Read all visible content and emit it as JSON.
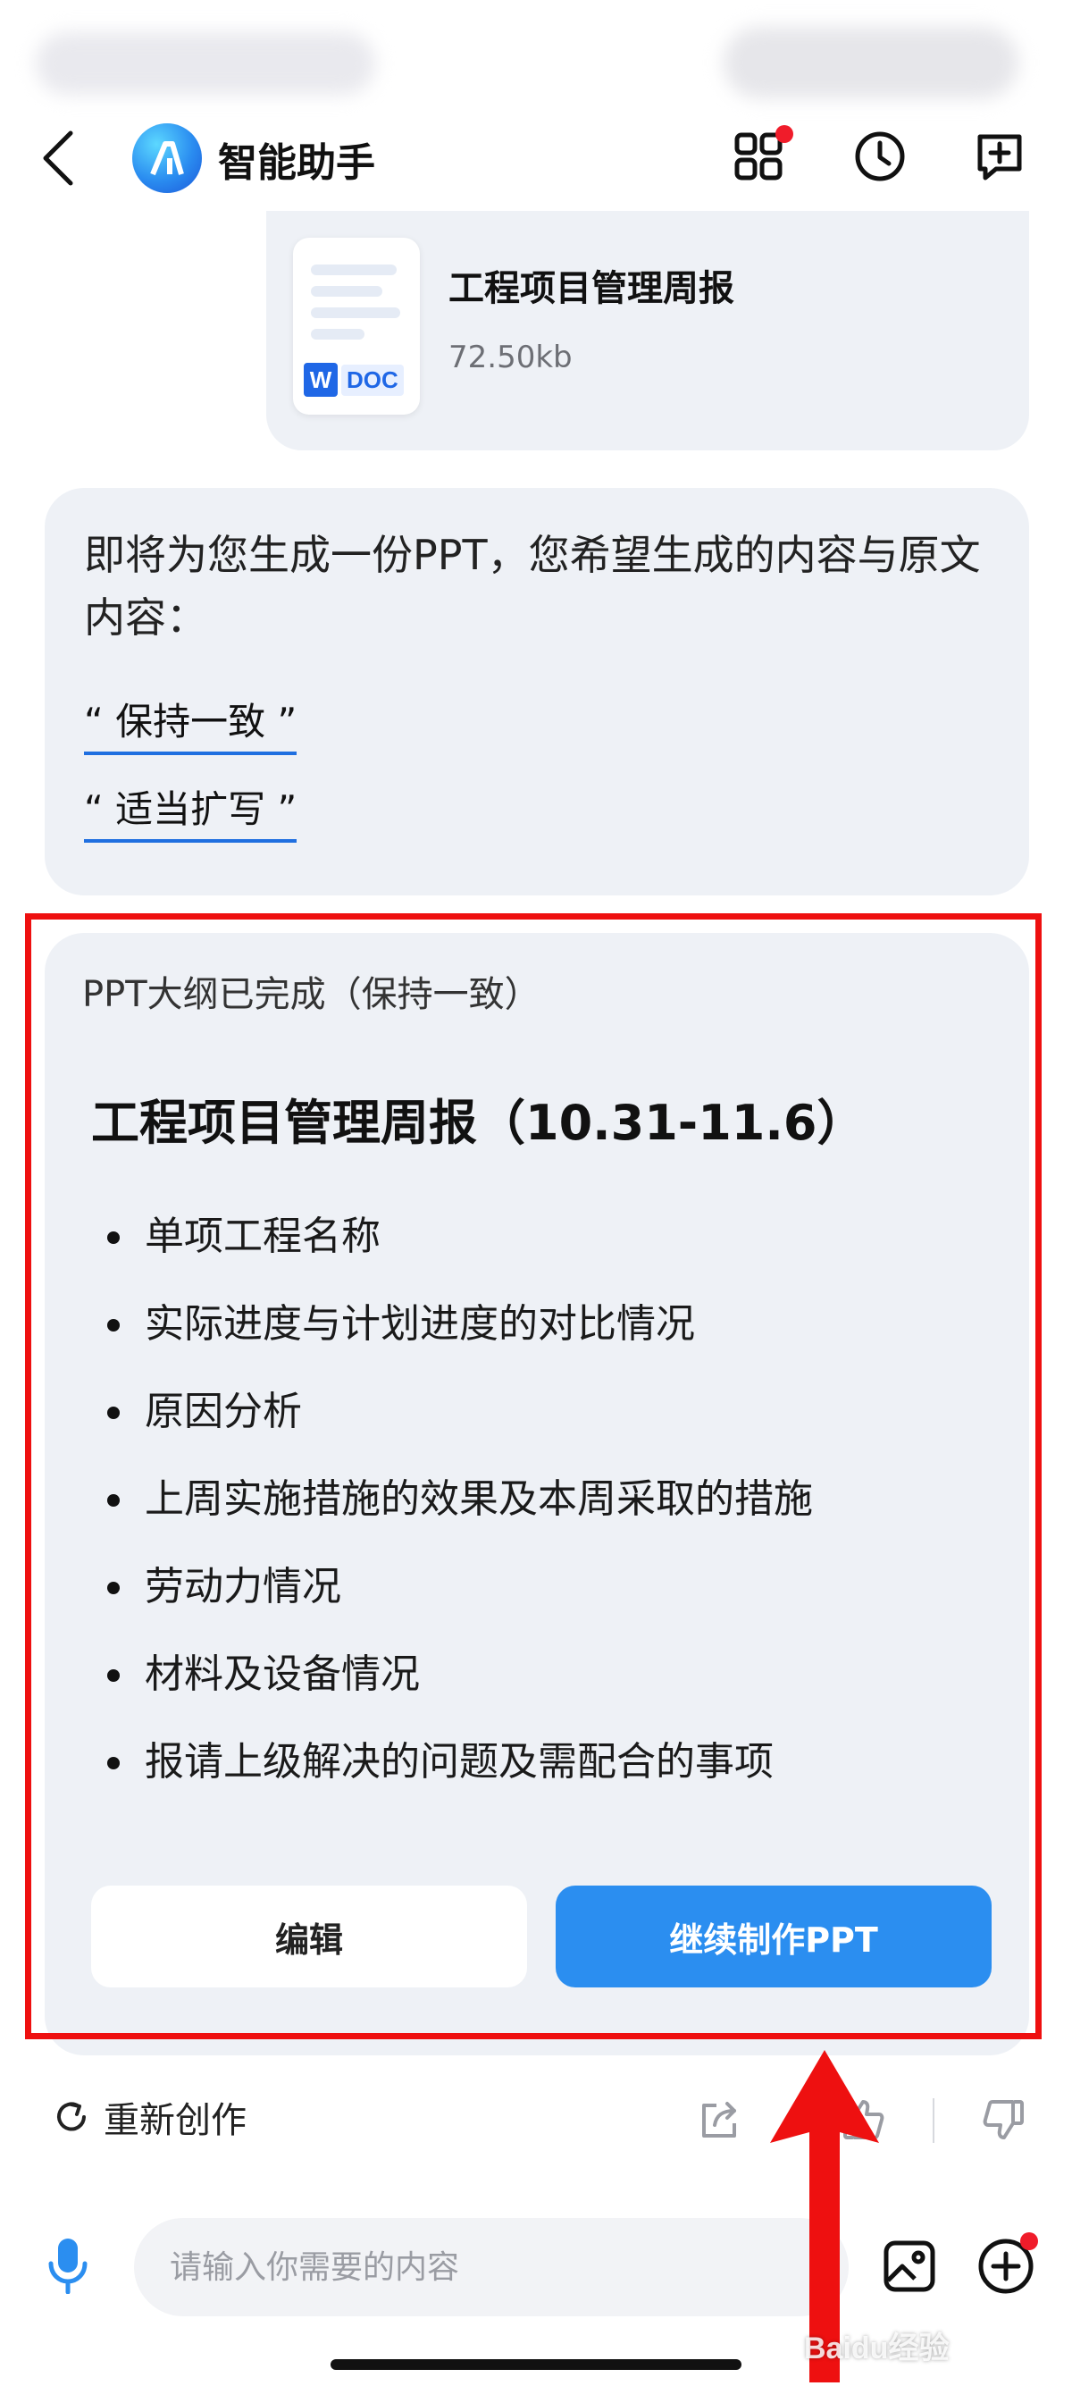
{
  "header": {
    "title": "智能助手",
    "icons": [
      "back-icon",
      "app-logo",
      "grid-apps-icon",
      "history-clock-icon",
      "new-chat-icon"
    ]
  },
  "file": {
    "name": "工程项目管理周报",
    "size": "72.50kb",
    "badge_w": "W",
    "badge_type": "DOC"
  },
  "prompt": {
    "text": "即将为您生成一份PPT，您希望生成的内容与原文内容：",
    "options": [
      "“ 保持一致 ”",
      "“ 适当扩写 ”"
    ]
  },
  "outline": {
    "status": "PPT大纲已完成（保持一致）",
    "title": "工程项目管理周报（10.31-11.6）",
    "items": [
      "单项工程名称",
      "实际进度与计划进度的对比情况",
      "原因分析",
      "上周实施措施的效果及本周采取的措施",
      "劳动力情况",
      "材料及设备情况",
      "报请上级解决的问题及需配合的事项"
    ],
    "edit_label": "编辑",
    "continue_label": "继续制作PPT"
  },
  "actions": {
    "regenerate_label": "重新创作",
    "icons": [
      "share-icon",
      "thumbs-up-icon",
      "thumbs-down-icon"
    ]
  },
  "input": {
    "placeholder": "请输入你需要的内容"
  },
  "watermark": "Baidu经验",
  "colors": {
    "accent": "#2b8ef0",
    "bubble": "#eef1f6",
    "highlight": "#ee1010",
    "notify_dot": "#f01c2a"
  }
}
